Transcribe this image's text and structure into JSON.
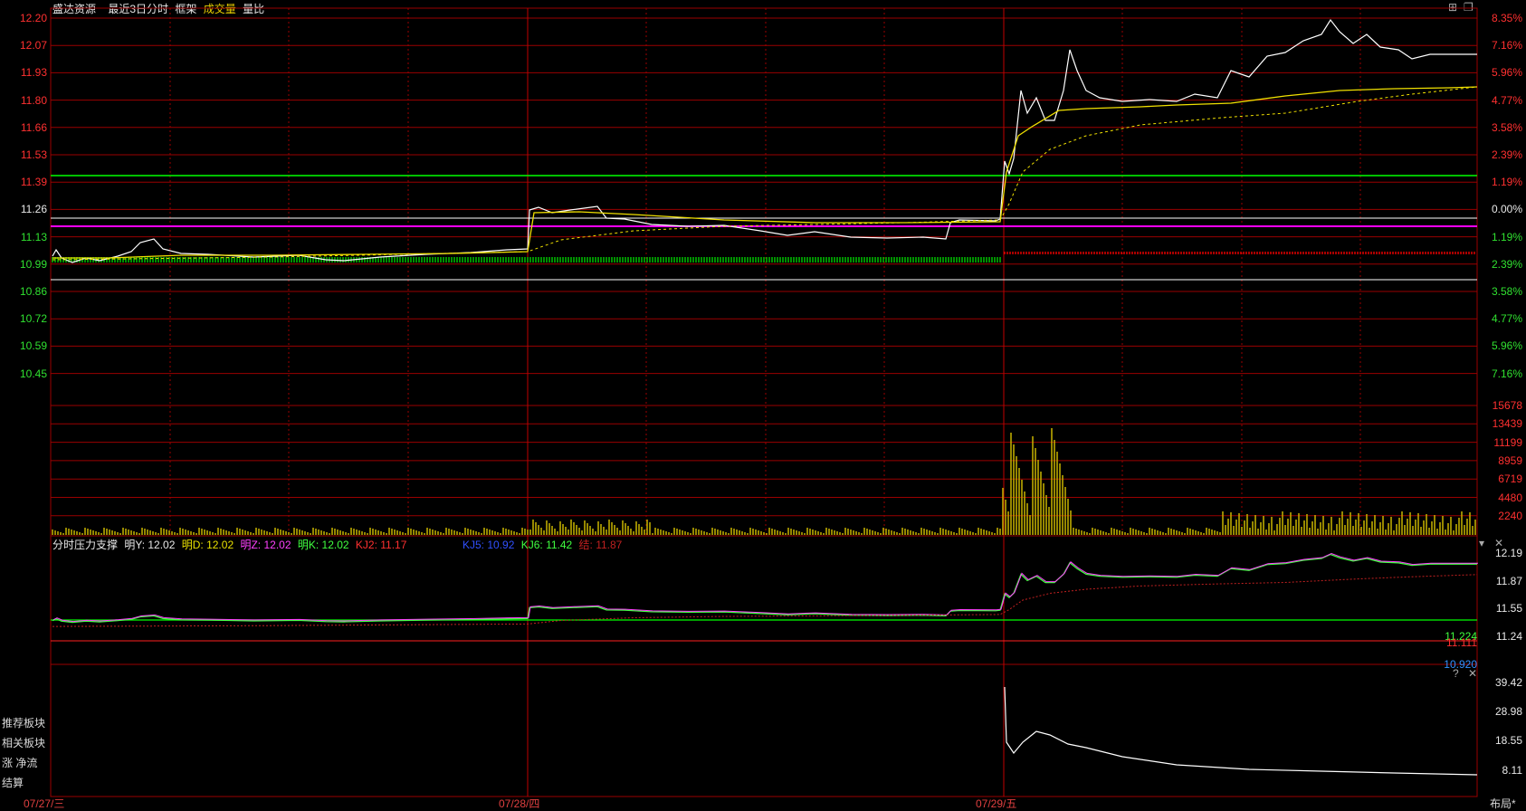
{
  "header": {
    "stock_name": "盛达资源",
    "period": "最近3日分时",
    "frame": "框架",
    "volume": "成交量",
    "volume_ratio": "量比"
  },
  "price_axis_left": [
    "12.20",
    "12.07",
    "11.93",
    "11.80",
    "11.66",
    "11.53",
    "11.39",
    "11.26",
    "11.13",
    "10.99",
    "10.86",
    "10.72",
    "10.59",
    "10.45"
  ],
  "price_axis_right": [
    "8.35%",
    "7.16%",
    "5.96%",
    "4.77%",
    "3.58%",
    "2.39%",
    "1.19%",
    "0.00%",
    "1.19%",
    "2.39%",
    "3.58%",
    "4.77%",
    "5.96%",
    "7.16%"
  ],
  "volume_axis": [
    "15678",
    "13439",
    "11199",
    "8959",
    "6719",
    "4480",
    "2240"
  ],
  "indicator": {
    "title": "分时压力支撑",
    "mingY": "明Y: 12.02",
    "mingD": "明D: 12.02",
    "mingZ": "明Z: 12.02",
    "mingK": "明K: 12.02",
    "kj2": "KJ2: 11.17",
    "kj5": "KJ5: 10.92",
    "kj6": "KJ6: 11.42",
    "kj_last": "结: 11.87",
    "axis": [
      "12.19",
      "11.87",
      "11.55",
      "11.24"
    ],
    "val_green": "11.224",
    "val_red": "11.111",
    "val_blue": "10.920"
  },
  "bottom_axis": [
    "39.42",
    "28.98",
    "18.55",
    "8.11"
  ],
  "side_labels": [
    "推荐板块",
    "相关板块",
    "涨  净流",
    "结算"
  ],
  "dates": [
    "07/27/三",
    "07/28/四",
    "07/29/五"
  ],
  "layout_button": "布局*",
  "colors": {
    "bg": "#000000",
    "grid": "#8b0000",
    "price_line": "#ffffff",
    "avg_line": "#f0e000",
    "green_line": "#00ff00",
    "magenta_line": "#ff00ff",
    "volume_bar": "#c8b400"
  }
}
